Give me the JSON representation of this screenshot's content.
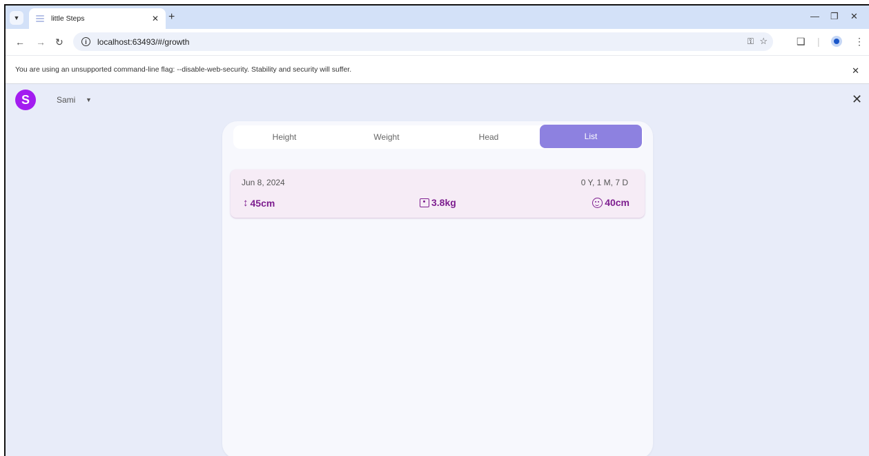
{
  "browser": {
    "tab_title": "little Steps",
    "url": "localhost:63493/#/growth"
  },
  "banner": {
    "text": "You are using an unsupported command-line flag: --disable-web-security. Stability and security will suffer."
  },
  "app": {
    "avatar_letter": "S",
    "user_name": "Sami"
  },
  "tabs": [
    {
      "label": "Height",
      "active": false
    },
    {
      "label": "Weight",
      "active": false
    },
    {
      "label": "Head",
      "active": false
    },
    {
      "label": "List",
      "active": true
    }
  ],
  "entries": [
    {
      "date": "Jun 8, 2024",
      "age": "0 Y, 1 M, 7 D",
      "height": "45cm",
      "weight": "3.8kg",
      "head": "40cm"
    }
  ],
  "colors": {
    "accent": "#8d81e0",
    "metric": "#7d1e8f",
    "avatar": "#a31cf0"
  },
  "icons": [
    "chevron-down-icon",
    "close-icon",
    "plus-icon",
    "back-arrow-icon",
    "forward-arrow-icon",
    "reload-icon",
    "info-icon",
    "key-icon",
    "star-icon",
    "extensions-icon",
    "profile-icon",
    "more-vert-icon",
    "height-icon",
    "scale-icon",
    "face-icon"
  ]
}
